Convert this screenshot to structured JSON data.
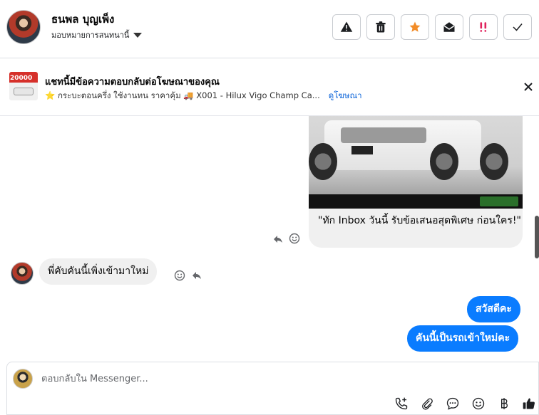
{
  "header": {
    "contact_name": "ธนพล บุญเพ็ง",
    "assign_label": "มอบหมายการสนทนานี้",
    "toolbar": [
      {
        "name": "report-button",
        "icon": "warning-icon"
      },
      {
        "name": "delete-button",
        "icon": "trash-icon"
      },
      {
        "name": "star-button",
        "icon": "star-icon",
        "color": "#f28c28"
      },
      {
        "name": "mark-unread-button",
        "icon": "envelope-open-icon"
      },
      {
        "name": "priority-button",
        "icon": "double-exclamation-icon",
        "color": "#e0245e"
      },
      {
        "name": "done-button",
        "icon": "check-icon"
      }
    ]
  },
  "ad_banner": {
    "thumb_price": "20000",
    "title": "แชทนี้มีข้อความตอบกลับต่อโฆษณาของคุณ",
    "subtitle": "⭐ กระบะตอนครึ่ง ใช้งานทน ราคาคุ้ม 🚚 X001 - Hilux Vigo Champ Ca...",
    "link": "ดูโฆษณา"
  },
  "messages": {
    "ad_card_text": "\"ทัก Inbox วันนี้ รับข้อเสนอสุดพิเศษ ก่อนใคร!\"",
    "incoming": "พี่คับคันนี้เพิ่งเข้ามาใหม่",
    "outgoing": [
      "สวัสดีคะ",
      "คันนี้เป็นรถเข้าใหม่คะ"
    ]
  },
  "composer": {
    "placeholder": "ตอบกลับใน Messenger..."
  },
  "colors": {
    "accent": "#0a7cff",
    "link": "#0a63d8",
    "bubble_in": "#f0f0f0"
  }
}
